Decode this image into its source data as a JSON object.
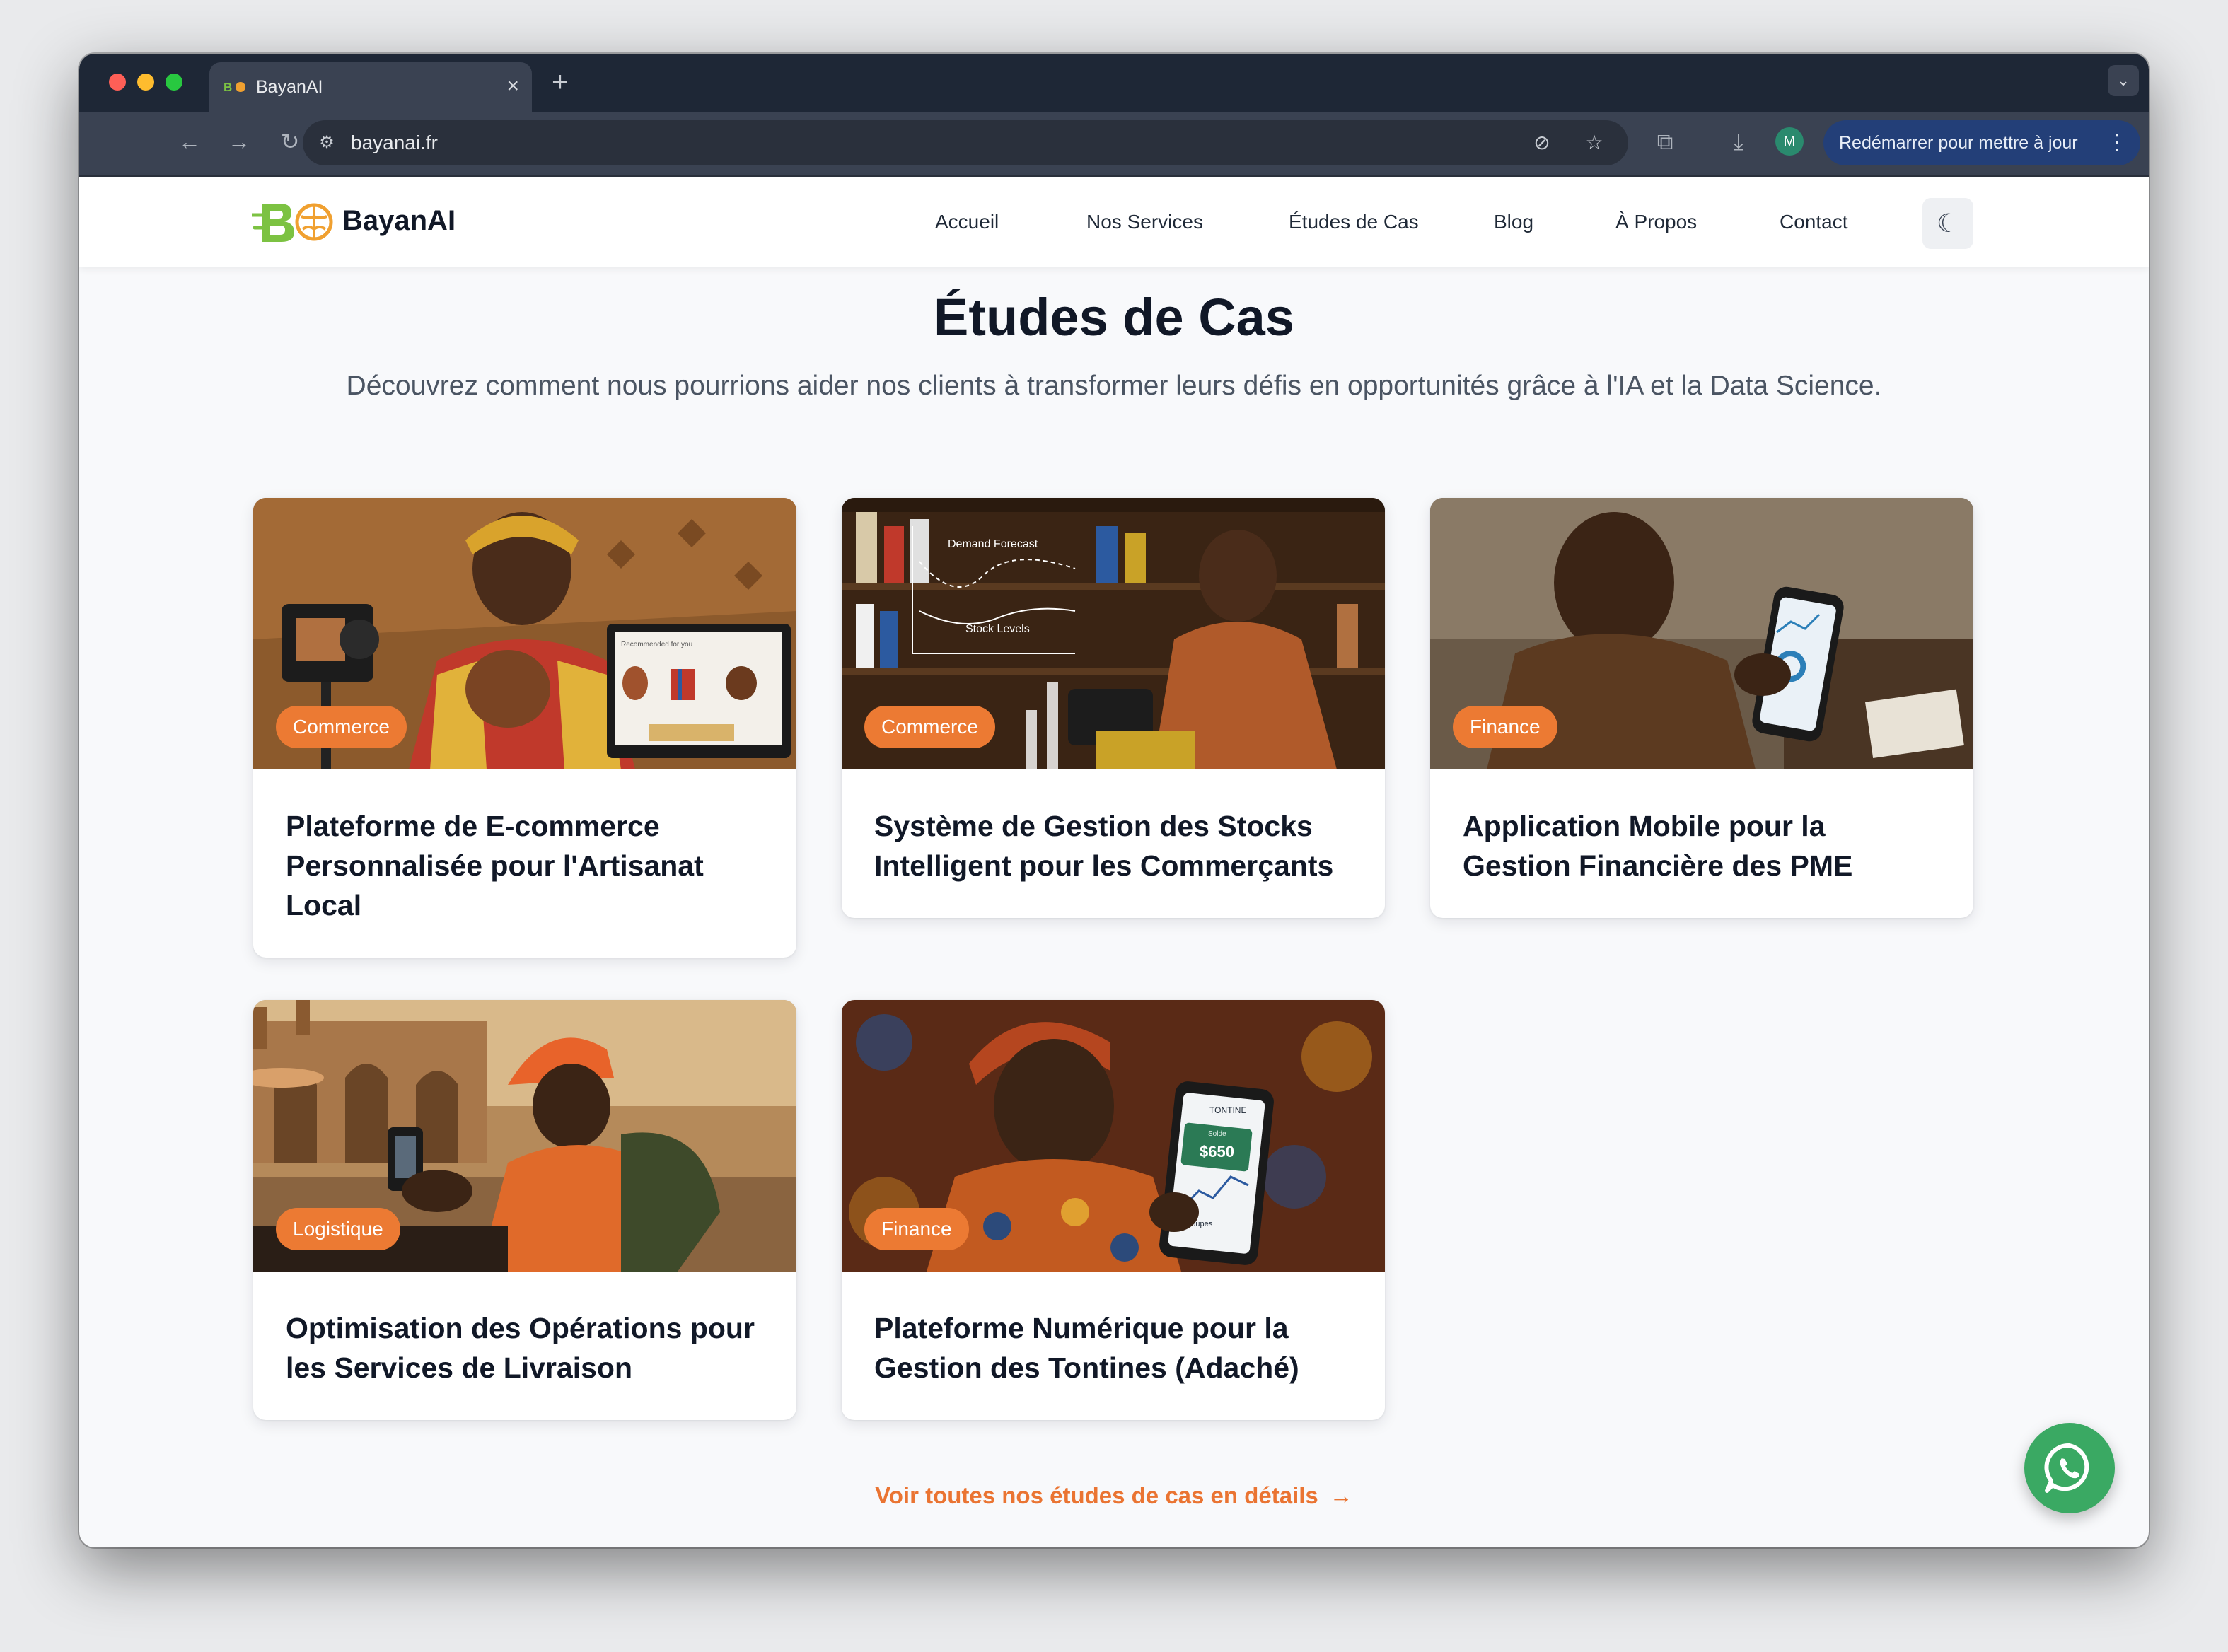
{
  "browser": {
    "tab_title": "BayanAI",
    "new_tab_icon": "+",
    "url": "bayanai.fr",
    "update_button": "Redémarrer pour mettre à jour",
    "profile_initial": "M"
  },
  "header": {
    "brand": "BayanAI",
    "nav": [
      "Accueil",
      "Nos Services",
      "Études de Cas",
      "Blog",
      "À Propos",
      "Contact"
    ],
    "theme_icon": "moon-icon"
  },
  "page": {
    "title": "Études de Cas",
    "subtitle": "Découvrez comment nous pourrions aider nos clients à transformer leurs défis en opportunités grâce à l'IA et la Data Science."
  },
  "cards": [
    {
      "category": "Commerce",
      "title": "Plateforme de E-commerce Personnalisée pour l'Artisanat Local"
    },
    {
      "category": "Commerce",
      "title": "Système de Gestion des Stocks Intelligent pour les Commerçants"
    },
    {
      "category": "Finance",
      "title": "Application Mobile pour la Gestion Financière des PME"
    },
    {
      "category": "Logistique",
      "title": "Optimisation des Opérations pour les Services de Livraison"
    },
    {
      "category": "Finance",
      "title": "Plateforme Numérique pour la Gestion des Tontines (Adaché)"
    }
  ],
  "image_text": {
    "laptop_caption": "Recommended for you",
    "chart_demand": "Demand Forecast",
    "chart_stock": "Stock Levels",
    "phone_header": "TONTINE",
    "phone_balance_label": "Solde",
    "phone_balance": "$650",
    "phone_groups": "Groupes"
  },
  "cta": {
    "see_all": "Voir toutes nos études de cas en détails"
  },
  "colors": {
    "accent": "#ec7a33",
    "whatsapp": "#3aa963",
    "update_button": "#233f78"
  }
}
